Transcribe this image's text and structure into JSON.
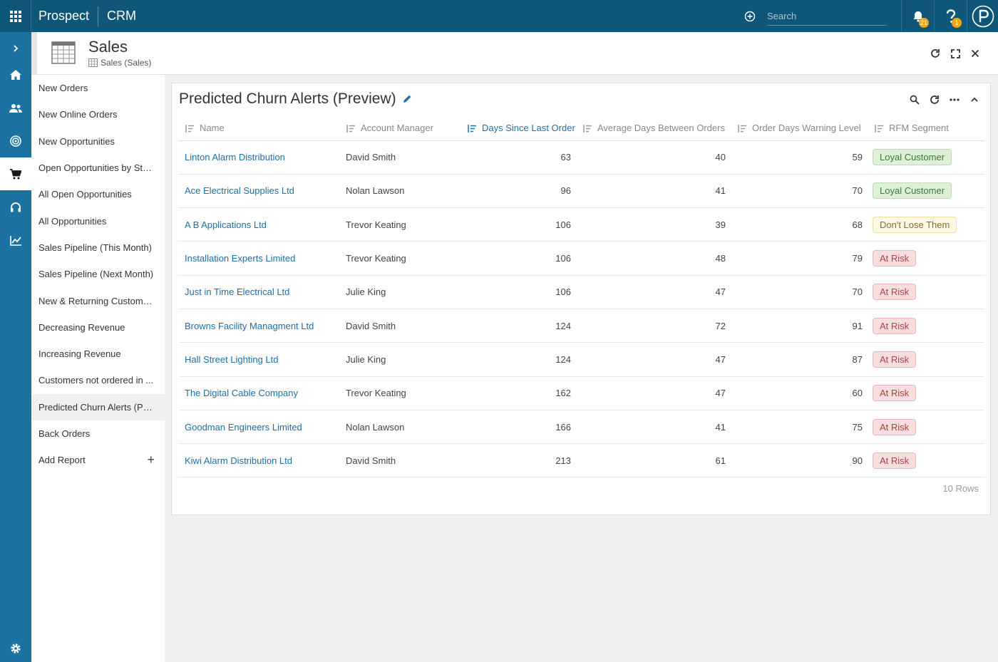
{
  "topbar": {
    "brand": "Prospect",
    "app": "CRM",
    "search_placeholder": "Search",
    "notifications_count": "21",
    "help_count": "1"
  },
  "header": {
    "title": "Sales",
    "subtitle": "Sales (Sales)"
  },
  "reports": {
    "items": [
      {
        "label": "New Orders"
      },
      {
        "label": "New Online Orders"
      },
      {
        "label": "New Opportunities"
      },
      {
        "label": "Open Opportunities by Sta..."
      },
      {
        "label": "All Open Opportunities"
      },
      {
        "label": "All Opportunities"
      },
      {
        "label": "Sales Pipeline (This Month)"
      },
      {
        "label": "Sales Pipeline (Next Month)"
      },
      {
        "label": "New & Returning Customers"
      },
      {
        "label": "Decreasing Revenue"
      },
      {
        "label": "Increasing Revenue"
      },
      {
        "label": "Customers not ordered in ..."
      },
      {
        "label": "Predicted Churn Alerts (Pre..."
      },
      {
        "label": "Back Orders"
      }
    ],
    "add_label": "Add Report",
    "active_index": 12
  },
  "panel": {
    "title": "Predicted Churn Alerts (Preview)",
    "rows_count": "10 Rows"
  },
  "table": {
    "columns": [
      "Name",
      "Account Manager",
      "Days Since Last Order",
      "Average Days Between Orders",
      "Order Days Warning Level",
      "RFM Segment"
    ],
    "sorted_column": 2,
    "rows": [
      {
        "name": "Linton Alarm Distribution",
        "manager": "David Smith",
        "days": "63",
        "avg": "40",
        "warn": "59",
        "segment": "Loyal Customer",
        "seg_color": "green"
      },
      {
        "name": "Ace Electrical Supplies Ltd",
        "manager": "Nolan Lawson",
        "days": "96",
        "avg": "41",
        "warn": "70",
        "segment": "Loyal Customer",
        "seg_color": "green"
      },
      {
        "name": "A B Applications Ltd",
        "manager": "Trevor Keating",
        "days": "106",
        "avg": "39",
        "warn": "68",
        "segment": "Don't Lose Them",
        "seg_color": "yellow"
      },
      {
        "name": "Installation Experts Limited",
        "manager": "Trevor Keating",
        "days": "106",
        "avg": "48",
        "warn": "79",
        "segment": "At Risk",
        "seg_color": "red"
      },
      {
        "name": "Just in Time Electrical Ltd",
        "manager": "Julie King",
        "days": "106",
        "avg": "47",
        "warn": "70",
        "segment": "At Risk",
        "seg_color": "red"
      },
      {
        "name": "Browns Facility Managment Ltd",
        "manager": "David Smith",
        "days": "124",
        "avg": "72",
        "warn": "91",
        "segment": "At Risk",
        "seg_color": "red"
      },
      {
        "name": "Hall Street Lighting Ltd",
        "manager": "Julie King",
        "days": "124",
        "avg": "47",
        "warn": "87",
        "segment": "At Risk",
        "seg_color": "red"
      },
      {
        "name": "The Digital Cable Company",
        "manager": "Trevor Keating",
        "days": "162",
        "avg": "47",
        "warn": "60",
        "segment": "At Risk",
        "seg_color": "red"
      },
      {
        "name": "Goodman Engineers Limited",
        "manager": "Nolan Lawson",
        "days": "166",
        "avg": "41",
        "warn": "75",
        "segment": "At Risk",
        "seg_color": "red"
      },
      {
        "name": "Kiwi Alarm Distribution Ltd",
        "manager": "David Smith",
        "days": "213",
        "avg": "61",
        "warn": "90",
        "segment": "At Risk",
        "seg_color": "red"
      }
    ]
  },
  "colors": {
    "topbar": "#0f5778",
    "sidebar": "#1b71a0",
    "link": "#1e6fa5"
  },
  "icons": {
    "sidebar": [
      "chevron-right-icon",
      "home-icon",
      "people-icon",
      "target-icon",
      "cart-icon",
      "headset-icon",
      "chart-icon",
      "gear-icon"
    ]
  }
}
